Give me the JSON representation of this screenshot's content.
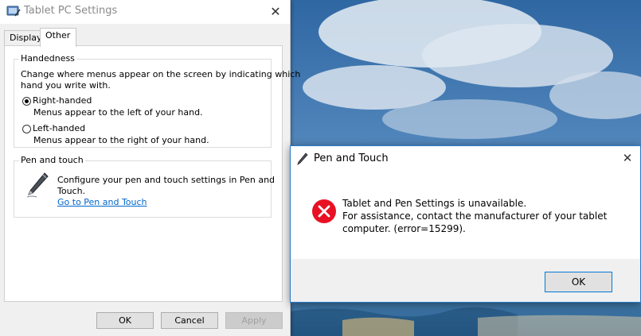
{
  "tablet_settings": {
    "title": "Tablet PC Settings",
    "close_glyph": "✕",
    "tabs": [
      {
        "label": "Display",
        "active": false
      },
      {
        "label": "Other",
        "active": true
      }
    ],
    "handedness": {
      "label": "Handedness",
      "description_line1": "Change where menus appear on the screen by indicating which",
      "description_line2": "hand you write with.",
      "options": [
        {
          "label": "Right-handed",
          "caption": "Menus appear to the left of your hand.",
          "checked": true
        },
        {
          "label": "Left-handed",
          "caption": "Menus appear to the right of your hand.",
          "checked": false
        }
      ]
    },
    "pen_touch": {
      "label": "Pen and touch",
      "description_line1": "Configure your pen and touch settings in Pen and",
      "description_line2": "Touch.",
      "link": "Go to Pen and Touch"
    },
    "buttons": {
      "ok": "OK",
      "cancel": "Cancel",
      "apply": "Apply"
    }
  },
  "pen_touch_dialog": {
    "title": "Pen and Touch",
    "close_glyph": "✕",
    "message_line1": "Tablet and Pen Settings is unavailable.",
    "message_line2": "For assistance, contact the manufacturer of your tablet",
    "message_line3": "computer. (error=15299).",
    "ok": "OK",
    "error_color": "#e81123"
  },
  "icons": {
    "window_icon": "tablet-pc-icon",
    "pen_icon": "pen-icon",
    "error_icon": "error-icon"
  }
}
